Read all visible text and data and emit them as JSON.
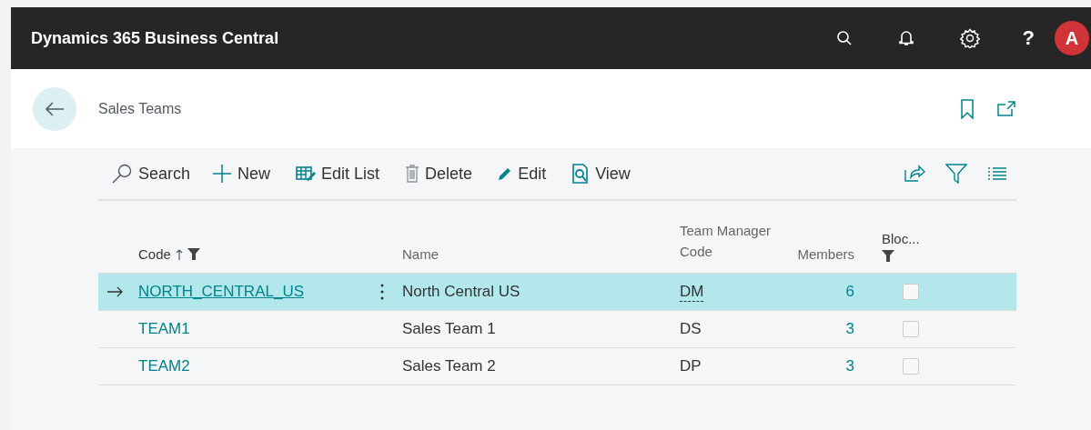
{
  "app": {
    "title": "Dynamics 365 Business Central",
    "avatar": "A",
    "help": "?"
  },
  "page": {
    "title": "Sales Teams"
  },
  "actions": [
    {
      "kind": "search",
      "label": "Search"
    },
    {
      "kind": "new",
      "label": "New"
    },
    {
      "kind": "editlist",
      "label": "Edit List"
    },
    {
      "kind": "delete",
      "label": "Delete"
    },
    {
      "kind": "edit",
      "label": "Edit"
    },
    {
      "kind": "view",
      "label": "View"
    }
  ],
  "table": {
    "columns": [
      {
        "label": "Code",
        "sorted": true,
        "filtered": true
      },
      {
        "label": "Name",
        "sorted": false,
        "filtered": false
      },
      {
        "label": "Team Manager Code",
        "sorted": false,
        "filtered": false
      },
      {
        "label": "Members",
        "sorted": false,
        "filtered": false
      },
      {
        "label": "Bloc...",
        "sorted": false,
        "filtered": true
      }
    ],
    "rows": [
      {
        "selected": true,
        "code": "NORTH_CENTRAL_US",
        "name": "North Central US",
        "manager": "DM",
        "members": "6",
        "blocked": false
      },
      {
        "selected": false,
        "code": "TEAM1",
        "name": "Sales Team 1",
        "manager": "DS",
        "members": "3",
        "blocked": false
      },
      {
        "selected": false,
        "code": "TEAM2",
        "name": "Sales Team 2",
        "manager": "DP",
        "members": "3",
        "blocked": false
      }
    ]
  }
}
